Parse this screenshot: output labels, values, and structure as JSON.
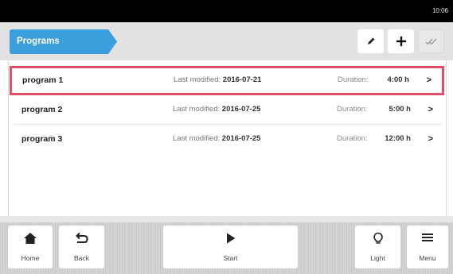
{
  "status_bar": {
    "time": "10:06"
  },
  "header": {
    "breadcrumb": "Programs",
    "breadcrumb_color": "#3a9fdc",
    "actions": [
      {
        "name": "edit",
        "icon": "pencil-icon",
        "enabled": true
      },
      {
        "name": "add",
        "icon": "plus-icon",
        "enabled": true
      },
      {
        "name": "multi-select",
        "icon": "double-check-icon",
        "enabled": false
      }
    ]
  },
  "programs": {
    "modified_label": "Last modified:",
    "duration_label": "Duration:",
    "items": [
      {
        "name": "program 1",
        "modified": "2016-07-21",
        "duration": "4:00 h",
        "selected": true
      },
      {
        "name": "program 2",
        "modified": "2016-07-25",
        "duration": "5:00 h",
        "selected": false
      },
      {
        "name": "program 3",
        "modified": "2016-07-25",
        "duration": "12:00 h",
        "selected": false
      }
    ],
    "selection_color": "#e0506b"
  },
  "footer": {
    "home": "Home",
    "back": "Back",
    "start": "Start",
    "light": "Light",
    "menu": "Menu"
  }
}
